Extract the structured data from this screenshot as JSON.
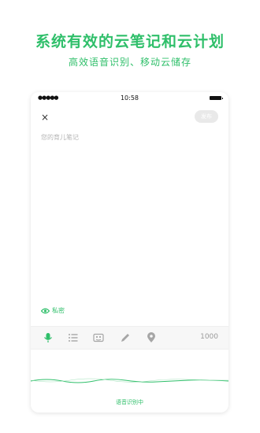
{
  "promo": {
    "headline": "系统有效的云笔记和云计划",
    "subline": "高效语音识别、移动云储存"
  },
  "status_bar": {
    "signal": "●●●●●",
    "time": "10:58"
  },
  "editor": {
    "close_glyph": "×",
    "publish_label": "发布",
    "placeholder": "您的育儿笔记",
    "privacy_label": "私密",
    "char_count": "1000"
  },
  "toolbar": {
    "icons": [
      "microphone-icon",
      "list-icon",
      "image-icon",
      "pen-icon",
      "location-icon"
    ]
  },
  "voice": {
    "status": "语音识别中"
  },
  "colors": {
    "accent": "#2fbf6a",
    "disabled_button": "#e9e9e9",
    "placeholder": "#b5b5b5",
    "icon_gray": "#a6a6a6"
  }
}
